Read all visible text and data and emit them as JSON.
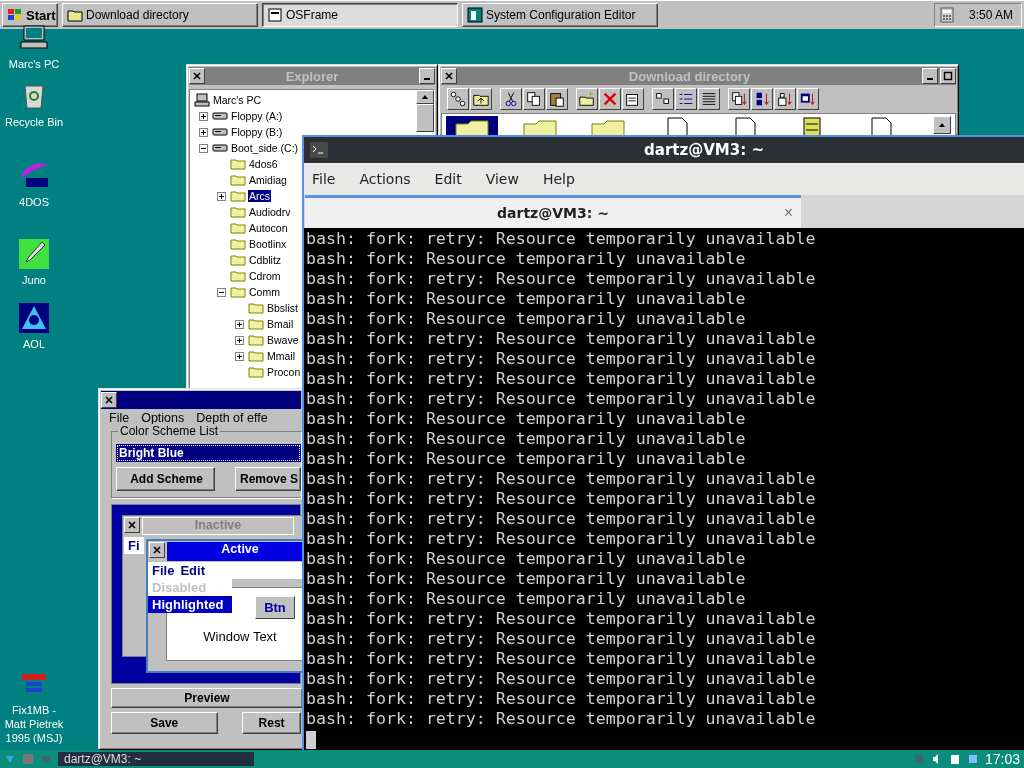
{
  "top_taskbar": {
    "start": "Start",
    "tasks": [
      {
        "label": "Download directory",
        "selected": false,
        "kind": "folder"
      },
      {
        "label": "OSFrame",
        "selected": true,
        "kind": "window"
      },
      {
        "label": "System Configuration Editor",
        "selected": false,
        "kind": "config"
      }
    ],
    "clock": "3:50 AM"
  },
  "desktop_icons": [
    {
      "label": "Marc's PC",
      "kind": "computer"
    },
    {
      "label": "Recycle Bin",
      "kind": "bin"
    },
    {
      "label": "4DOS",
      "kind": "fourdos"
    },
    {
      "label": "Juno",
      "kind": "juno"
    },
    {
      "label": "AOL",
      "kind": "aol"
    },
    {
      "label": "Fix1MB - Matt Pietrek 1995 (MSJ)",
      "kind": "fix"
    }
  ],
  "explorer": {
    "title": "Explorer",
    "tree": [
      {
        "label": "Marc's PC",
        "kind": "computer",
        "selected": false,
        "children": [
          {
            "label": "Floppy (A:)",
            "kind": "drive",
            "selected": false,
            "expanded": false
          },
          {
            "label": "Floppy (B:)",
            "kind": "drive",
            "selected": false,
            "expanded": false
          },
          {
            "label": "Boot_side (C:)",
            "kind": "drive",
            "selected": false,
            "expanded": true,
            "children": [
              {
                "label": "4dos6",
                "kind": "folder",
                "selected": false
              },
              {
                "label": "Amidiag",
                "kind": "folder",
                "selected": false
              },
              {
                "label": "Arcs",
                "kind": "folder",
                "selected": true,
                "expanded": false
              },
              {
                "label": "Audiodrv",
                "kind": "folder",
                "selected": false
              },
              {
                "label": "Autocon",
                "kind": "folder",
                "selected": false
              },
              {
                "label": "Bootlinx",
                "kind": "folder",
                "selected": false
              },
              {
                "label": "Cdblitz",
                "kind": "folder",
                "selected": false
              },
              {
                "label": "Cdrom",
                "kind": "folder",
                "selected": false
              },
              {
                "label": "Comm",
                "kind": "folder",
                "selected": false,
                "expanded": true,
                "children": [
                  {
                    "label": "Bbslist",
                    "kind": "folder",
                    "selected": false
                  },
                  {
                    "label": "Bmail",
                    "kind": "folder",
                    "selected": false,
                    "expanded": false
                  },
                  {
                    "label": "Bwave",
                    "kind": "folder",
                    "selected": false,
                    "expanded": false
                  },
                  {
                    "label": "Mmail",
                    "kind": "folder",
                    "selected": false,
                    "expanded": false
                  },
                  {
                    "label": "Procon",
                    "kind": "folder",
                    "selected": false
                  }
                ]
              }
            ]
          }
        ]
      }
    ]
  },
  "download_directory": {
    "title": "Download directory",
    "files": [
      {
        "kind": "folder",
        "selected": true
      },
      {
        "kind": "folder",
        "selected": false
      },
      {
        "kind": "folder",
        "selected": false
      },
      {
        "kind": "document",
        "selected": false
      },
      {
        "kind": "document",
        "selected": false
      },
      {
        "kind": "cabinet",
        "selected": false
      },
      {
        "kind": "document",
        "selected": false
      }
    ]
  },
  "color_window": {
    "menu": [
      "File",
      "Options",
      "Depth of effe"
    ],
    "group": "Color Scheme List",
    "scheme": "Bright Blue",
    "buttons": [
      "Add Scheme",
      "Remove S"
    ],
    "preview": {
      "inactive_title": "Inactive",
      "inactive_menu": "Fi",
      "active_title": "Active",
      "active_menu": [
        "File",
        "Edit"
      ],
      "menu_items": [
        {
          "label": "Disabled",
          "disabled": true,
          "selected": false
        },
        {
          "label": "Highlighted",
          "disabled": false,
          "selected": true
        }
      ],
      "button": "Btn",
      "window_text": "Window Text"
    },
    "preview_button": "Preview",
    "bottom_buttons": [
      "Save",
      "Rest"
    ]
  },
  "terminal": {
    "title": "dartz@VM3: ~",
    "menu": [
      "File",
      "Actions",
      "Edit",
      "View",
      "Help"
    ],
    "tab": "dartz@VM3: ~",
    "tab_close": "×",
    "lines": [
      "bash: fork: retry: Resource temporarily unavailable",
      "bash: fork: Resource temporarily unavailable",
      "bash: fork: retry: Resource temporarily unavailable",
      "bash: fork: Resource temporarily unavailable",
      "bash: fork: Resource temporarily unavailable",
      "bash: fork: retry: Resource temporarily unavailable",
      "bash: fork: retry: Resource temporarily unavailable",
      "bash: fork: retry: Resource temporarily unavailable",
      "bash: fork: retry: Resource temporarily unavailable",
      "bash: fork: Resource temporarily unavailable",
      "bash: fork: Resource temporarily unavailable",
      "bash: fork: Resource temporarily unavailable",
      "bash: fork: retry: Resource temporarily unavailable",
      "bash: fork: retry: Resource temporarily unavailable",
      "bash: fork: retry: Resource temporarily unavailable",
      "bash: fork: retry: Resource temporarily unavailable",
      "bash: fork: Resource temporarily unavailable",
      "bash: fork: Resource temporarily unavailable",
      "bash: fork: Resource temporarily unavailable",
      "bash: fork: retry: Resource temporarily unavailable",
      "bash: fork: retry: Resource temporarily unavailable",
      "bash: fork: retry: Resource temporarily unavailable",
      "bash: fork: retry: Resource temporarily unavailable",
      "bash: fork: retry: Resource temporarily unavailable",
      "bash: fork: retry: Resource temporarily unavailable"
    ]
  },
  "bottom_panel": {
    "task": "dartz@VM3: ~",
    "clock": "17:03"
  }
}
